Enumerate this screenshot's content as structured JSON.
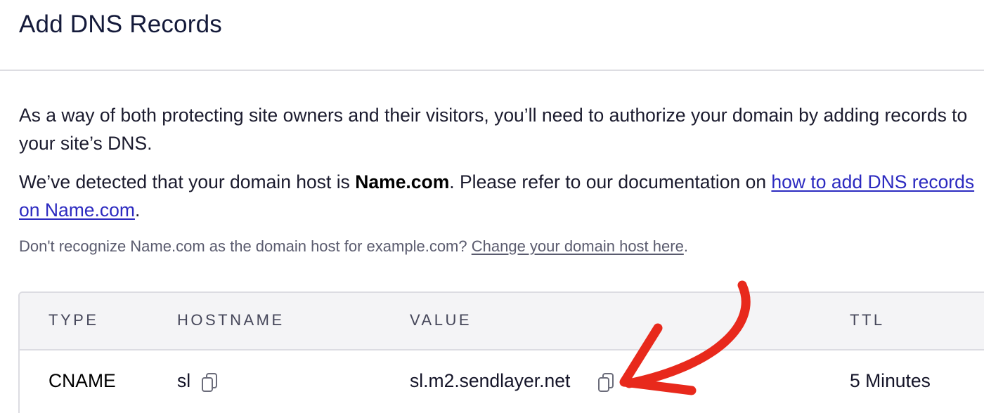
{
  "header": {
    "title": "Add DNS Records"
  },
  "intro": {
    "text": "As a way of both protecting site owners and their visitors, you’ll need to authorize your domain by adding records to your site’s DNS."
  },
  "detected": {
    "prefix": "We’ve detected that your domain host is ",
    "host": "Name.com",
    "middle": ". Please refer to our documentation on ",
    "link_text": "how to add DNS records on Name.com",
    "suffix": "."
  },
  "note": {
    "prefix": "Don't recognize Name.com as the domain host for example.com? ",
    "link_text": "Change your domain host here",
    "suffix": "."
  },
  "table": {
    "headers": {
      "type": "TYPE",
      "hostname": "HOSTNAME",
      "value": "VALUE",
      "ttl": "TTL"
    },
    "rows": [
      {
        "type": "CNAME",
        "hostname": "sl",
        "value": "sl.m2.sendlayer.net",
        "ttl": "5 Minutes"
      }
    ]
  },
  "icons": {
    "copy": "copy-icon",
    "annotation": "red-arrow"
  },
  "colors": {
    "link": "#2c2ac0",
    "arrow": "#e8291c",
    "header_bg": "#f4f4f6"
  }
}
